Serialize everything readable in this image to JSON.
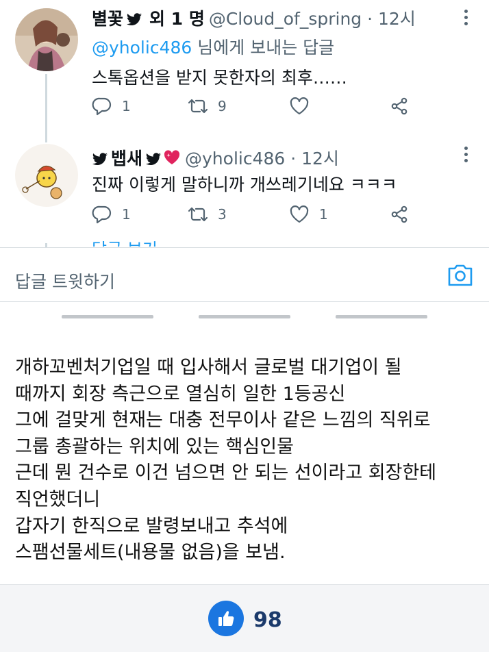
{
  "tweets": [
    {
      "name": "별꽃",
      "suffix": "외 1 명",
      "handle": "@Cloud_of_spring · 12시",
      "reply_prefix": "@yholic486",
      "reply_suffix": " 님에게 보내는 답글",
      "text": "스톡옵션을 받지 못한자의 최후……",
      "replies": "1",
      "retweets": "9",
      "likes": ""
    },
    {
      "name": "뱁새",
      "handle": "@yholic486 · 12시",
      "text": "진짜 이렇게 말하니까 개쓰레기네요 ㅋㅋㅋ",
      "replies": "1",
      "retweets": "3",
      "likes": "1"
    }
  ],
  "cut_off_text": "답글 보기",
  "reply_bar": {
    "placeholder": "답글 트윗하기"
  },
  "caption_lines": [
    "개하꼬벤처기업일 때 입사해서 글로벌 대기업이 될",
    "때까지 회장 측근으로 열심히 일한 1등공신",
    "그에 걸맞게 현재는 대충 전무이사 같은 느낌의 직위로",
    "그룹 총괄하는 위치에 있는 핵심인물",
    "근데 뭔 건수로 이건 넘으면 안 되는 선이라고 회장한테",
    "직언했더니",
    "갑자기 한직으로 발령보내고 추석에",
    "스팸선물세트(내용물 없음)을 보냄."
  ],
  "footer": {
    "like_count": "98"
  },
  "colors": {
    "twitter_blue": "#1d9bf0",
    "secondary_text": "#536471",
    "like_button": "#1b76e0",
    "like_count": "#1b3a6b"
  }
}
